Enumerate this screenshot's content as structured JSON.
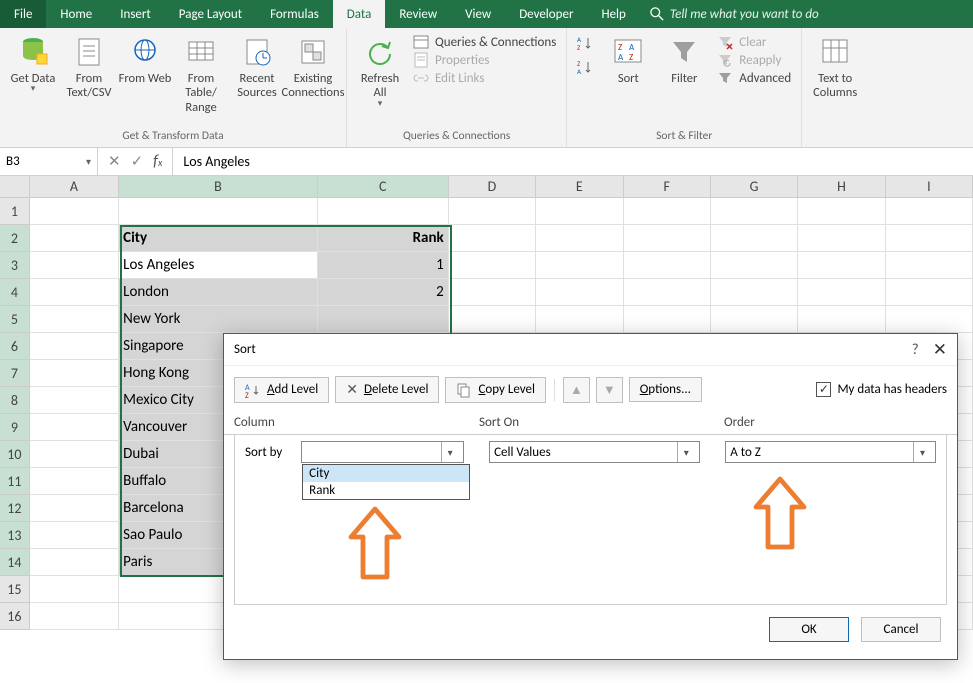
{
  "ribbon": {
    "tabs": [
      "File",
      "Home",
      "Insert",
      "Page Layout",
      "Formulas",
      "Data",
      "Review",
      "View",
      "Developer",
      "Help"
    ],
    "active": "Data",
    "tell_me": "Tell me what you want to do",
    "groups": {
      "get_transform": {
        "label": "Get & Transform Data",
        "get_data": "Get Data",
        "from_text": "From Text/CSV",
        "from_web": "From Web",
        "from_table": "From Table/ Range",
        "recent": "Recent Sources",
        "existing": "Existing Connections"
      },
      "queries_conn": {
        "label": "Queries & Connections",
        "refresh": "Refresh All",
        "queries": "Queries & Connections",
        "properties": "Properties",
        "edit_links": "Edit Links"
      },
      "sort_filter": {
        "label": "Sort & Filter",
        "sort": "Sort",
        "filter": "Filter",
        "clear": "Clear",
        "reapply": "Reapply",
        "advanced": "Advanced"
      },
      "data_tools": {
        "text_cols": "Text to Columns"
      }
    }
  },
  "formula_bar": {
    "name_box": "B3",
    "formula": "Los Angeles"
  },
  "columns": [
    "A",
    "B",
    "C",
    "D",
    "E",
    "F",
    "G",
    "H",
    "I"
  ],
  "data": {
    "header": {
      "city": "City",
      "rank": "Rank"
    },
    "rows": [
      {
        "city": "Los Angeles",
        "rank": "1"
      },
      {
        "city": "London",
        "rank": "2"
      },
      {
        "city": "New York",
        "rank": ""
      },
      {
        "city": "Singapore",
        "rank": ""
      },
      {
        "city": "Hong Kong",
        "rank": ""
      },
      {
        "city": "Mexico City",
        "rank": ""
      },
      {
        "city": "Vancouver",
        "rank": ""
      },
      {
        "city": "Dubai",
        "rank": ""
      },
      {
        "city": "Buffalo",
        "rank": ""
      },
      {
        "city": "Barcelona",
        "rank": ""
      },
      {
        "city": "Sao Paulo",
        "rank": ""
      },
      {
        "city": "Paris",
        "rank": ""
      }
    ]
  },
  "dialog": {
    "title": "Sort",
    "add_level": "Add Level",
    "delete_level": "Delete Level",
    "copy_level": "Copy Level",
    "options": "Options...",
    "headers_check": "My data has headers",
    "col_header": "Column",
    "sorton_header": "Sort On",
    "order_header": "Order",
    "sort_by_label": "Sort by",
    "sort_by_value": "",
    "sort_on_value": "Cell Values",
    "order_value": "A to Z",
    "options_list": [
      "City",
      "Rank"
    ],
    "ok": "OK",
    "cancel": "Cancel"
  }
}
